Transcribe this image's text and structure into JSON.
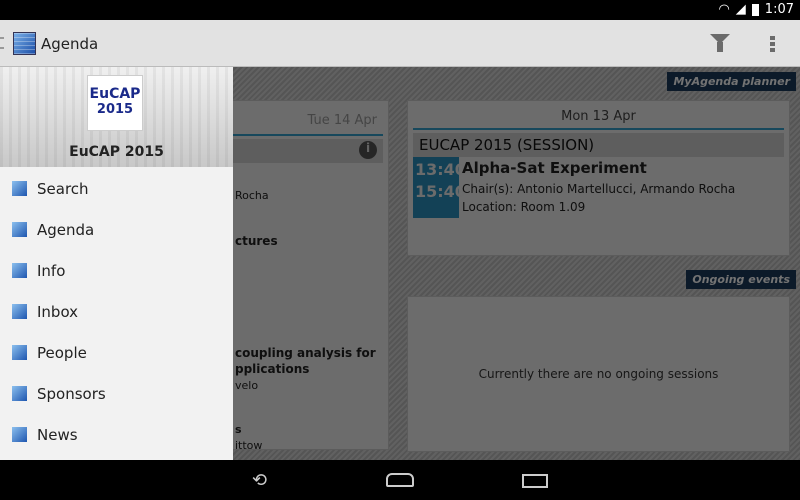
{
  "status": {
    "time": "1:07"
  },
  "actionbar": {
    "title": "Agenda"
  },
  "left_column": {
    "date": "Tue 14 Apr",
    "lines": [
      "Rocha",
      "ctures",
      "coupling analysis for",
      "pplications",
      "velo",
      "s",
      "ittow"
    ]
  },
  "myagenda": {
    "tag": "MyAgenda planner",
    "date": "Mon 13 Apr",
    "session": "EUCAP 2015 (SESSION)",
    "event": {
      "start": "13:40",
      "end": "15:40",
      "title": "Alpha-Sat Experiment",
      "chairs": "Chair(s): Antonio Martellucci, Armando Rocha",
      "location": "Location: Room 1.09"
    }
  },
  "ongoing": {
    "tag": "Ongoing events",
    "empty": "Currently there are no ongoing sessions"
  },
  "drawer": {
    "logo_text": "EuCAP 2015",
    "title": "EuCAP 2015",
    "items": [
      {
        "label": "Search",
        "icon": "search-icon"
      },
      {
        "label": "Agenda",
        "icon": "calendar-icon"
      },
      {
        "label": "Info",
        "icon": "info-icon"
      },
      {
        "label": "Inbox",
        "icon": "inbox-icon"
      },
      {
        "label": "People",
        "icon": "people-icon"
      },
      {
        "label": "Sponsors",
        "icon": "sponsors-icon"
      },
      {
        "label": "News",
        "icon": "news-icon"
      }
    ]
  },
  "colors": {
    "accent": "#2a90c0",
    "tag": "#1a3a5c"
  }
}
